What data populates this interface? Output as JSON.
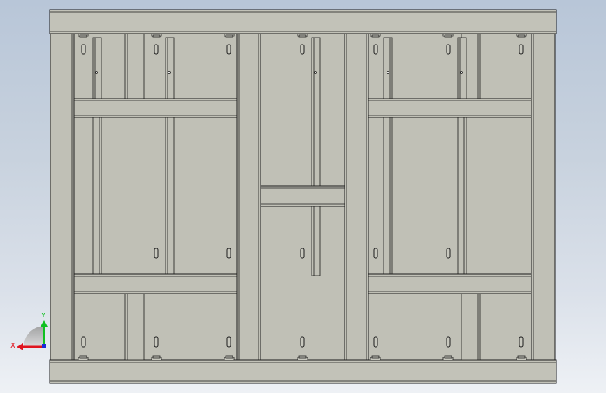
{
  "view": {
    "background_top": "#b8c6d8",
    "background_bottom": "#eef1f5",
    "part_fill": "#c0c0b6",
    "part_stroke": "#1a1a1a"
  },
  "triad": {
    "x_label": "X",
    "y_label": "Y",
    "x_color": "#e0141e",
    "y_color": "#10c020",
    "z_color": "#1a2ad8"
  }
}
